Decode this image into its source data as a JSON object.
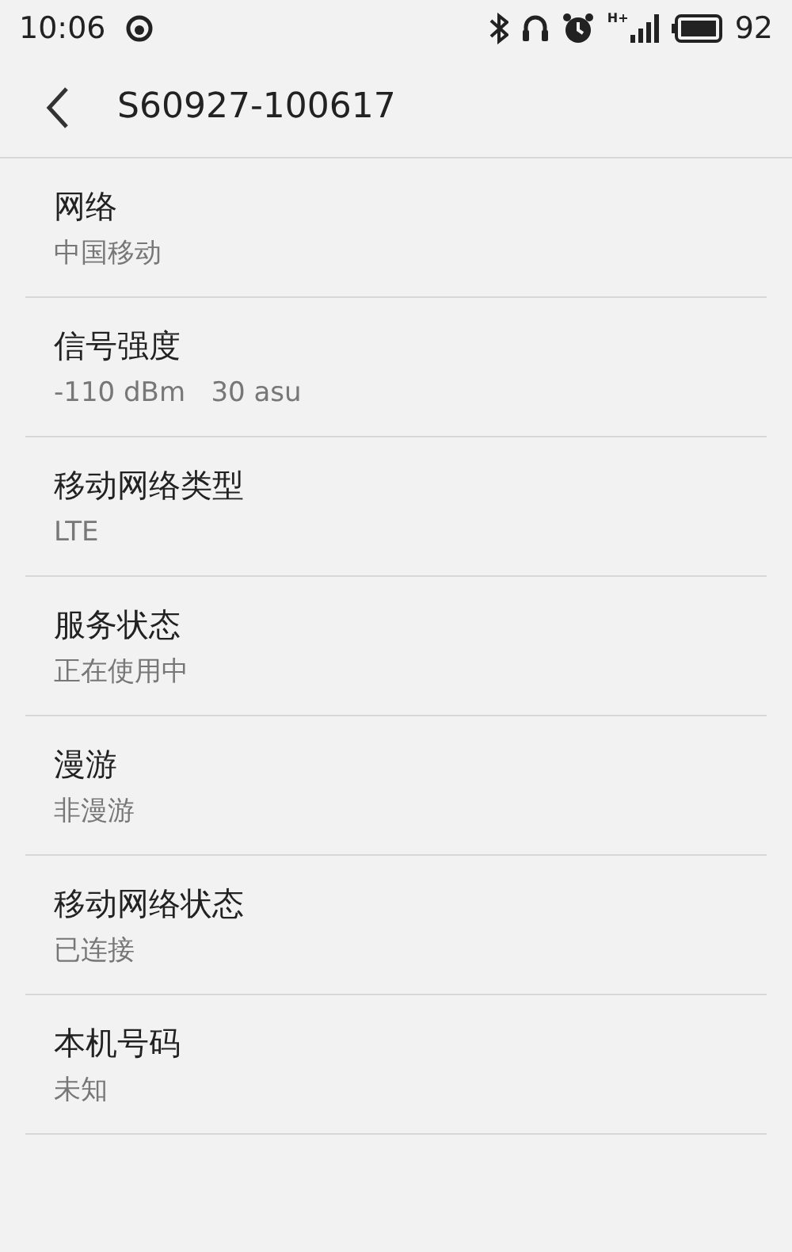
{
  "status_bar": {
    "time": "10:06",
    "network_type": "H+",
    "battery": "92"
  },
  "header": {
    "title": "S60927-100617"
  },
  "items": [
    {
      "label": "网络",
      "value": "中国移动"
    },
    {
      "label": "信号强度",
      "value": "-110 dBm   30 asu"
    },
    {
      "label": "移动网络类型",
      "value": "LTE"
    },
    {
      "label": "服务状态",
      "value": "正在使用中"
    },
    {
      "label": "漫游",
      "value": "非漫游"
    },
    {
      "label": "移动网络状态",
      "value": "已连接"
    },
    {
      "label": "本机号码",
      "value": "未知"
    }
  ]
}
